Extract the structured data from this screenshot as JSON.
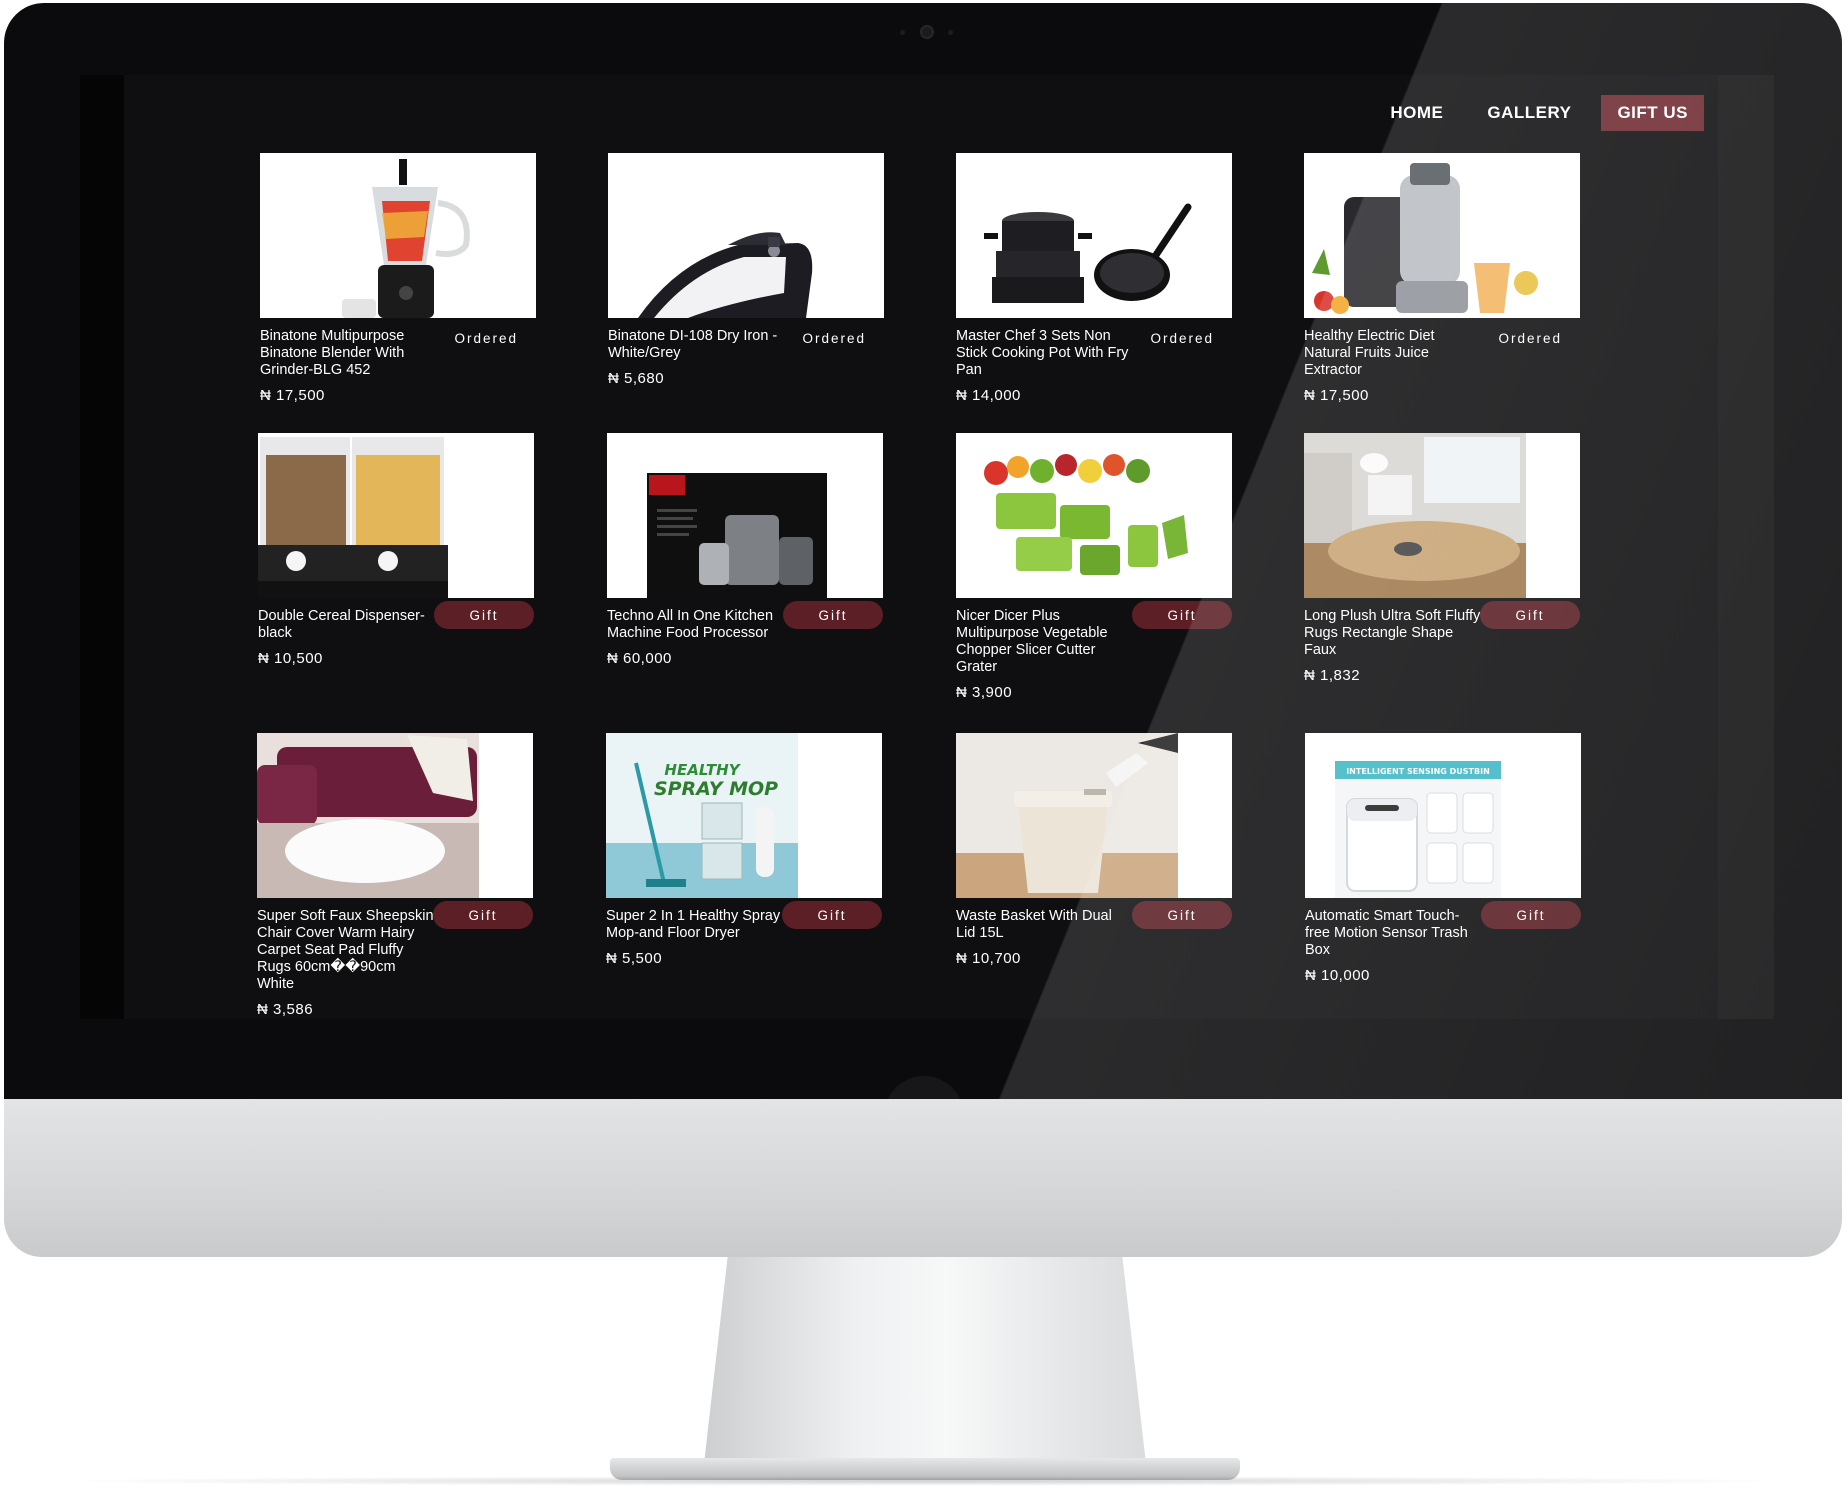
{
  "nav": {
    "home": "HOME",
    "gallery": "GALLERY",
    "gift_us": "GIFT US"
  },
  "currency_symbol": "₦",
  "products": [
    {
      "title": "Binatone Multipurpose Binatone Blender With Grinder-BLG 452",
      "price": "₦ 17,500",
      "action": "Ordered",
      "image": "blender"
    },
    {
      "title": "Binatone DI-108 Dry Iron - White/Grey",
      "price": "₦ 5,680",
      "action": "Ordered",
      "image": "iron"
    },
    {
      "title": "Master Chef 3 Sets Non Stick Cooking Pot With Fry Pan",
      "price": "₦ 14,000",
      "action": "Ordered",
      "image": "pots"
    },
    {
      "title": "Healthy Electric Diet Natural Fruits Juice Extractor",
      "price": "₦ 17,500",
      "action": "Ordered",
      "image": "juicer"
    },
    {
      "title": "Double Cereal Dispenser-black",
      "price": "₦ 10,500",
      "action": "Gift",
      "image": "cereal-dispenser"
    },
    {
      "title": "Techno All In One Kitchen Machine Food Processor",
      "price": "₦ 60,000",
      "action": "Gift",
      "image": "food-processor-box"
    },
    {
      "title": "Nicer Dicer Plus Multipurpose Vegetable Chopper Slicer Cutter Grater",
      "price": "₦ 3,900",
      "action": "Gift",
      "image": "vegetable-chopper"
    },
    {
      "title": "Long Plush Ultra Soft Fluffy Rugs Rectangle Shape Faux",
      "price": "₦ 1,832",
      "action": "Gift",
      "image": "plush-rug-room"
    },
    {
      "title": "Super Soft Faux Sheepskin Chair Cover Warm Hairy Carpet Seat Pad Fluffy Rugs 60cm��90cm White",
      "price": "₦ 3,586",
      "action": "Gift",
      "image": "sheepskin-rug"
    },
    {
      "title": "Super 2 In 1 Healthy Spray Mop-and Floor Dryer",
      "price": "₦ 5,500",
      "action": "Gift",
      "image": "spray-mop"
    },
    {
      "title": "Waste Basket With Dual Lid 15L",
      "price": "₦ 10,700",
      "action": "Gift",
      "image": "waste-basket"
    },
    {
      "title": "Automatic Smart Touch-free Motion Sensor Trash Box",
      "price": "₦ 10,000",
      "action": "Gift",
      "image": "sensor-trash-bin"
    }
  ],
  "image_text": {
    "spray_mop_banner_1": "HEALTHY",
    "spray_mop_banner_2": "SPRAY MOP",
    "trash_bin_banner": "INTELLIGENT SENSING DUSTBIN"
  },
  "colors": {
    "accent": "#6e2a31",
    "gift_button": "#5b1f25",
    "screen_bg": "#0f0f11"
  }
}
